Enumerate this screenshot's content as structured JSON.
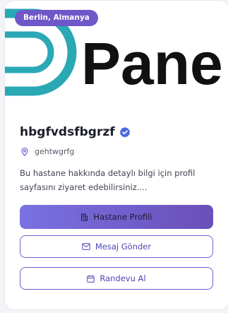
{
  "card": {
    "location_badge": "Berlin, Almanya",
    "cover_logo_text": "Pane",
    "hospital_name": "hbgfvdsfbgrzf",
    "address": "gehtwgrfg",
    "description": "Bu hastane hakkında detaylı bilgi için profil sayfasını ziyaret edebilirsiniz....",
    "buttons": {
      "profile_label": "Hastane Profili",
      "message_label": "Mesaj Gönder",
      "appointment_label": "Randevu Al"
    }
  },
  "colors": {
    "accent": "#6b63d6",
    "badge": "#6f57c9",
    "logo_teal": "#2aa9b5",
    "verified": "#4a68e0"
  },
  "icons": {
    "verified": "verified-check-icon",
    "address": "map-pin-icon",
    "profile": "building-icon",
    "message": "mail-icon",
    "appointment": "calendar-icon"
  }
}
